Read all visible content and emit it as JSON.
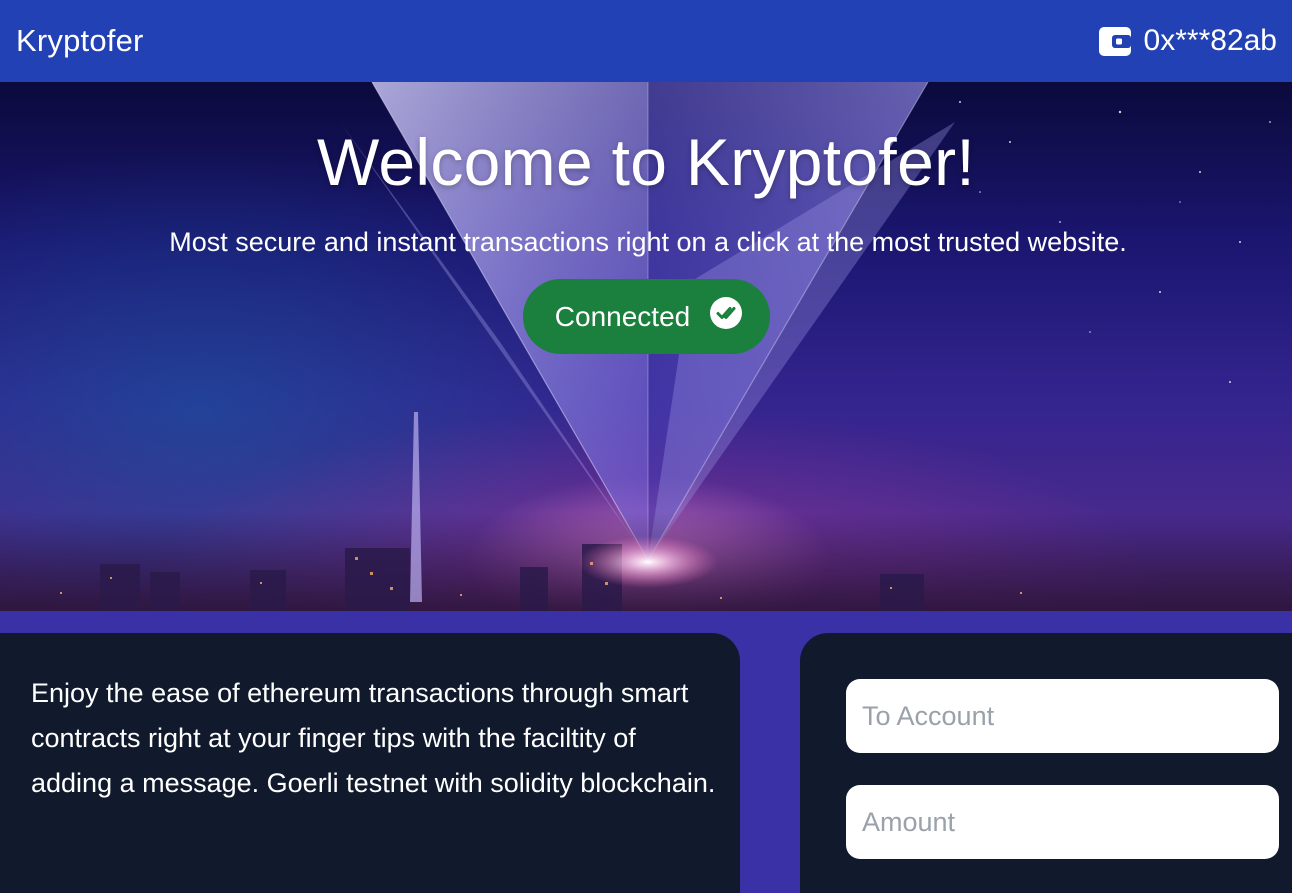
{
  "header": {
    "brand": "Kryptofer",
    "wallet_icon": "wallet-icon",
    "account_address": "0x***82ab"
  },
  "hero": {
    "title": "Welcome to Kryptofer!",
    "subtitle": "Most secure and instant transactions right on a click at the most trusted website.",
    "connect_status_label": "Connected",
    "connect_status_icon": "double-check-circle-icon"
  },
  "info_card": {
    "text": "Enjoy the ease of ethereum transactions through smart contracts right at your finger tips with the faciltity of adding a message. Goerli testnet with solidity blockchain."
  },
  "transfer_form": {
    "to_account_placeholder": "To Account",
    "amount_placeholder": "Amount"
  },
  "colors": {
    "header_bg": "#2241b4",
    "page_bg": "#3b31a6",
    "card_bg": "#111a2c",
    "connected_green": "#1b7f3d"
  }
}
